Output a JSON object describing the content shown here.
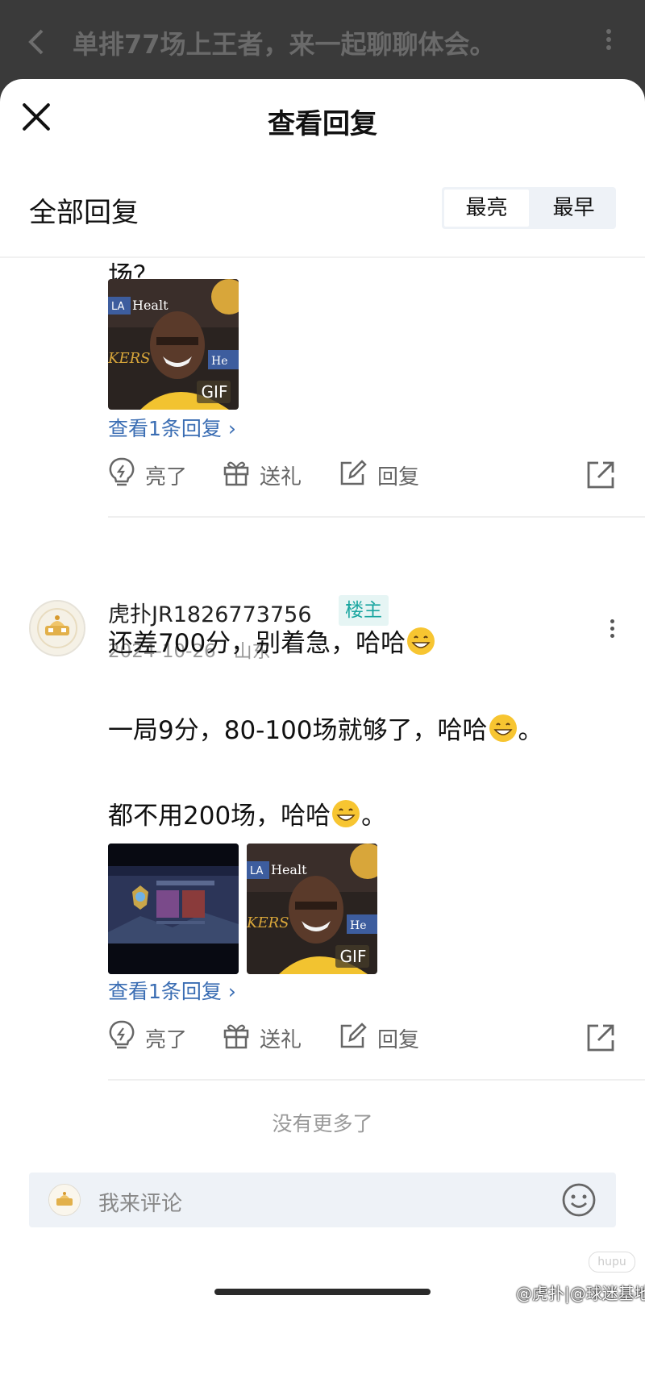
{
  "background_header": {
    "title": "单排77场上王者，来一起聊聊体会。"
  },
  "sheet": {
    "title": "查看回复",
    "section_label": "全部回复",
    "sort_options": [
      {
        "label": "最亮",
        "active": true
      },
      {
        "label": "最早",
        "active": false
      }
    ]
  },
  "reply_1": {
    "tail_text": "场？",
    "image_badge": "GIF",
    "view_replies": "查看1条回复 ›",
    "actions": {
      "like": "亮了",
      "gift": "送礼",
      "reply": "回复"
    }
  },
  "reply_2": {
    "username": "虎扑JR1826773756",
    "badge": "楼主",
    "meta": "2024-10-26 · 山东",
    "lines": [
      "还差700分，别着急，哈哈",
      "一局9分，80-100场就够了，哈哈",
      "都不用200场，哈哈"
    ],
    "line_suffixes": [
      "",
      "。",
      "。"
    ],
    "image_badge": "GIF",
    "view_replies": "查看1条回复 ›",
    "actions": {
      "like": "亮了",
      "gift": "送礼",
      "reply": "回复"
    }
  },
  "footer": {
    "no_more": "没有更多了",
    "comment_placeholder": "我来评论"
  },
  "watermark": "@虎扑|@球迷基地",
  "colors": {
    "link": "#3a6db3",
    "badge_text": "#1aa6a0",
    "badge_bg": "#e6f5f4",
    "toggle_bg": "#eef2f7"
  },
  "icons": [
    "close-icon",
    "back-icon",
    "more-icon",
    "lightbulb-icon",
    "gift-icon",
    "edit-icon",
    "share-icon",
    "emoji-icon"
  ]
}
